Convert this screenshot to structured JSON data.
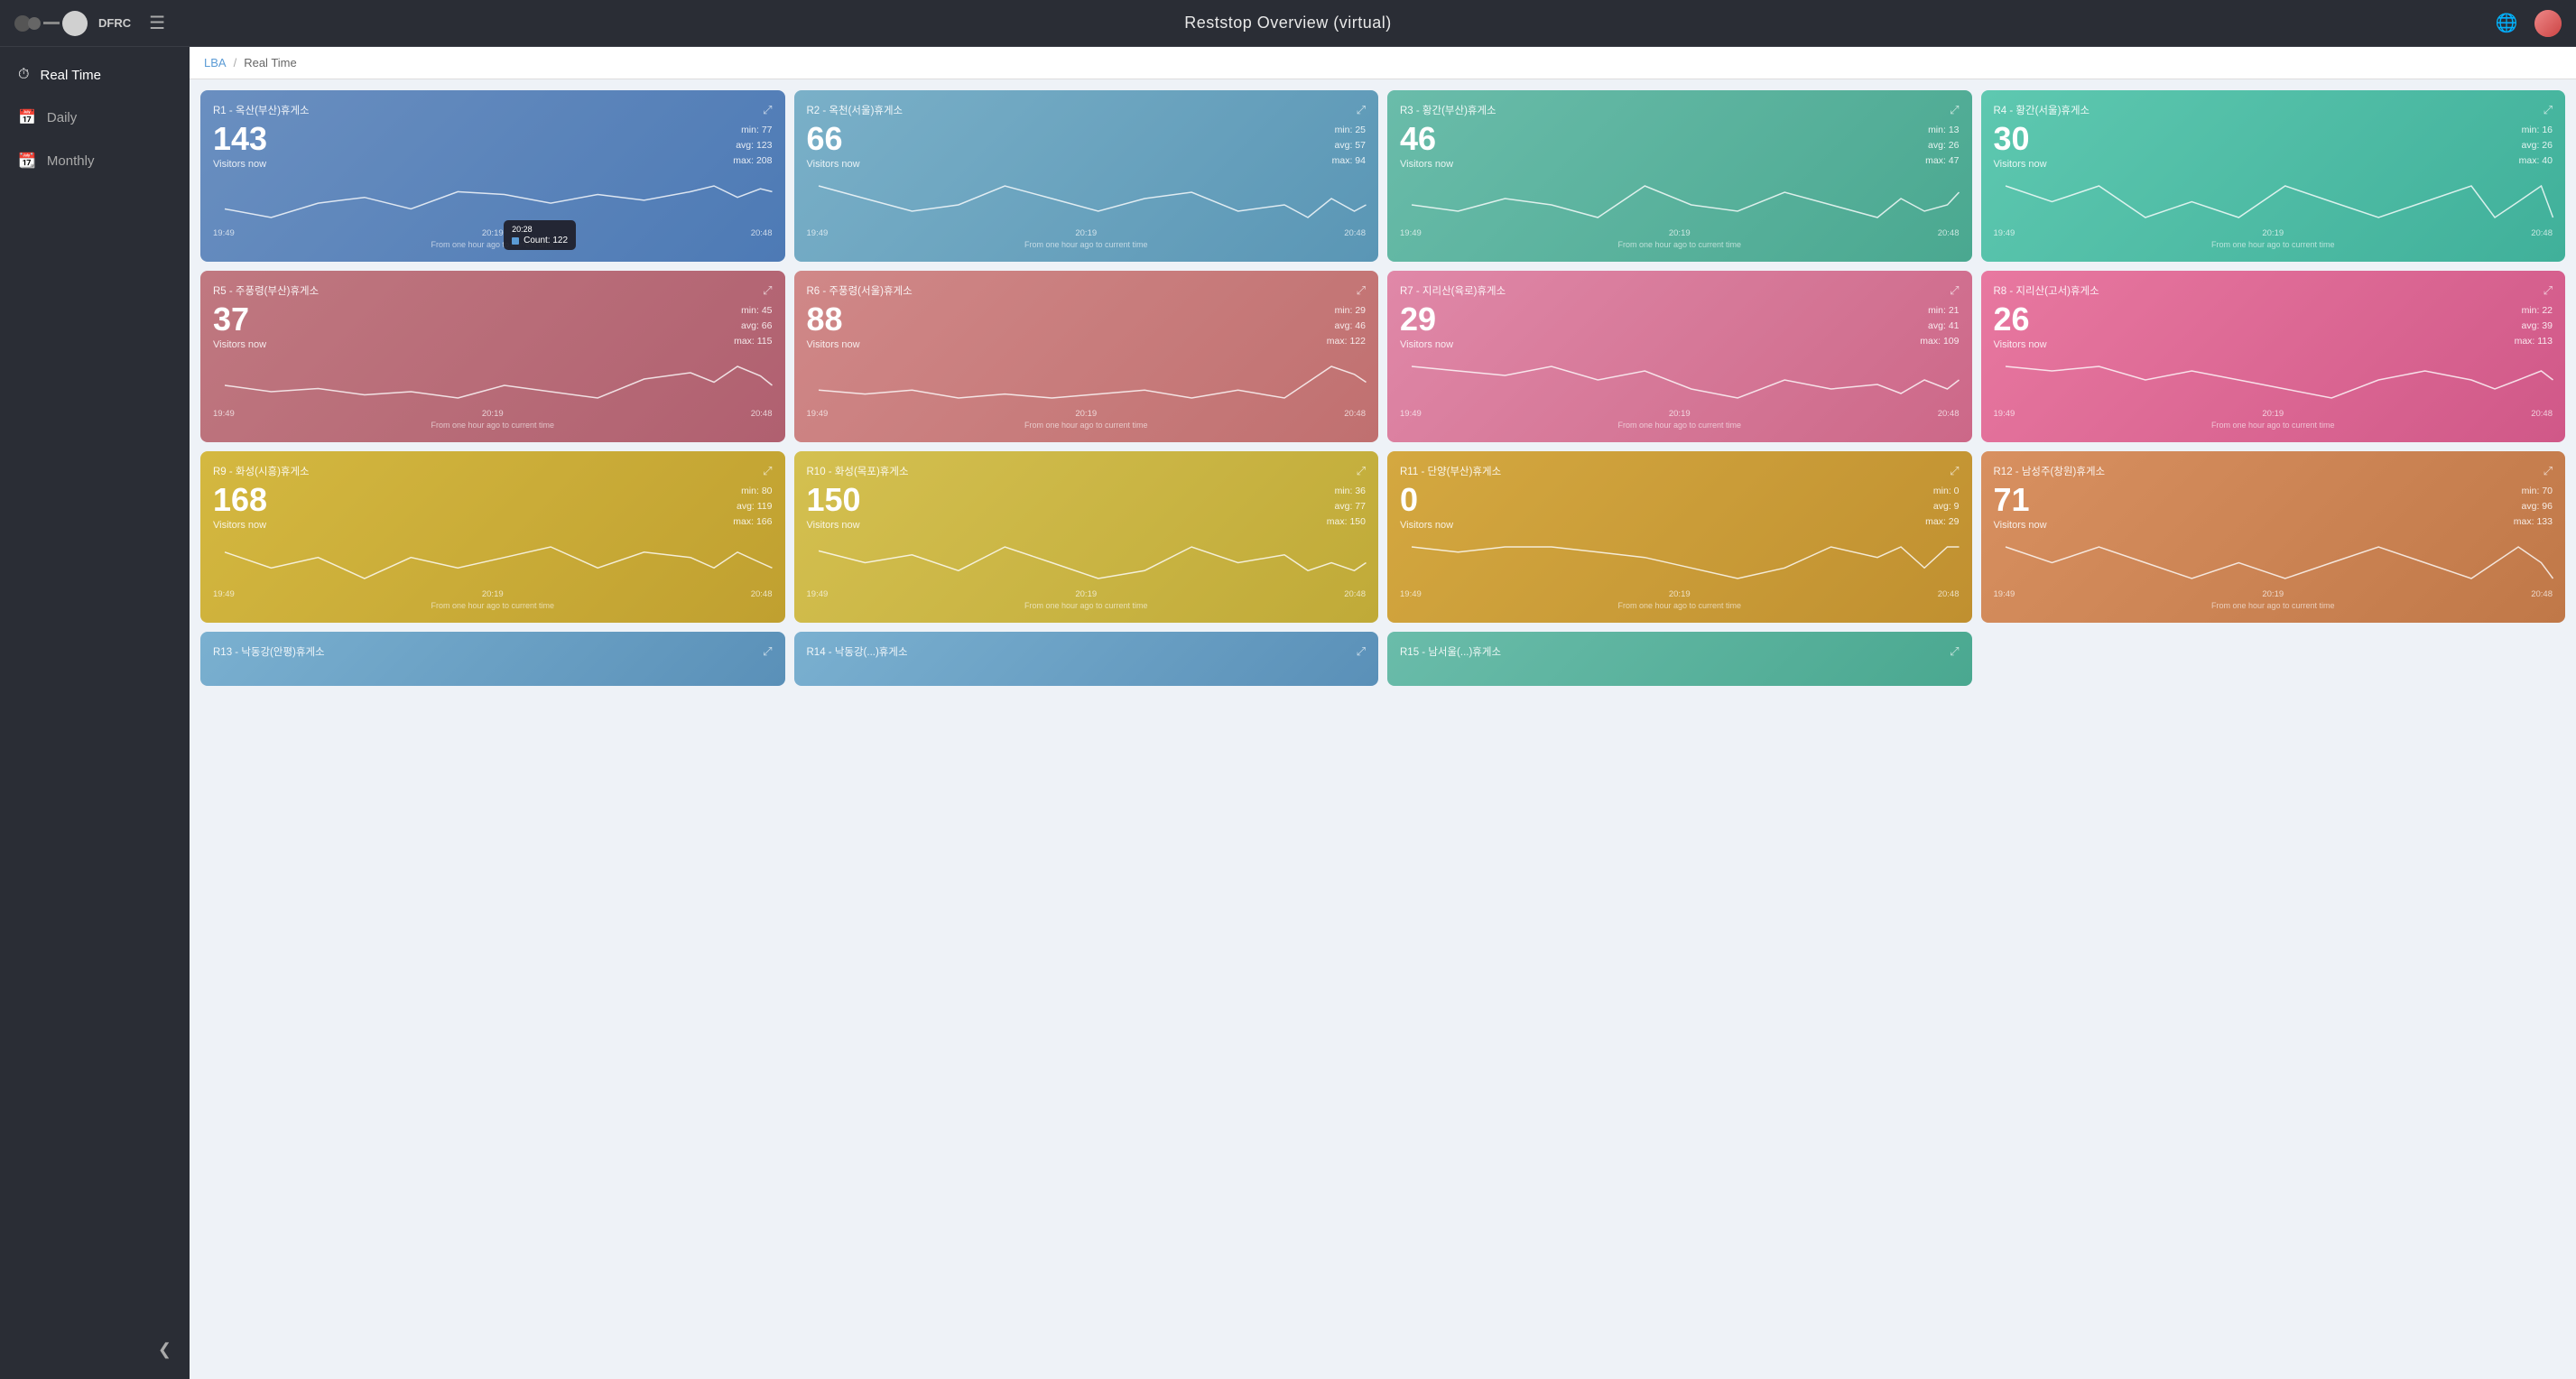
{
  "header": {
    "title": "Reststop Overview (virtual)",
    "logo_text": "DFRC"
  },
  "breadcrumb": {
    "link": "LBA",
    "separator": "/",
    "current": "Real Time"
  },
  "sidebar": {
    "items": [
      {
        "id": "realtime",
        "label": "Real Time",
        "icon": "⏱",
        "active": true
      },
      {
        "id": "daily",
        "label": "Daily",
        "icon": "📅",
        "active": false
      },
      {
        "id": "monthly",
        "label": "Monthly",
        "icon": "📆",
        "active": false
      }
    ],
    "collapse_label": "❮"
  },
  "cards": [
    {
      "id": "r1",
      "title": "R1 - 옥산(부산)휴게소",
      "count": "143",
      "label": "Visitors now",
      "min": 77,
      "avg": 123,
      "max": 208,
      "color_start": "#6a8fc0",
      "color_end": "#4d7ab5",
      "times": [
        "19:49",
        "20:19",
        "20:48"
      ],
      "footnote": "From one hour ago to current time",
      "tooltip": {
        "show": true,
        "time": "20:28",
        "count": 122
      },
      "sparkline": "5,38 25,35 45,40 65,42 85,38 105,44 125,43 145,40 165,43 185,41 205,44 215,46 225,42 235,45 240,44"
    },
    {
      "id": "r2",
      "title": "R2 - 옥천(서울)휴게소",
      "count": "66",
      "label": "Visitors now",
      "min": 25,
      "avg": 57,
      "max": 94,
      "color_start": "#7ab0c8",
      "color_end": "#5a96b5",
      "times": [
        "19:49",
        "20:19",
        "20:48"
      ],
      "footnote": "From one hour ago to current time",
      "tooltip": {
        "show": false
      },
      "sparkline": "5,42 25,40 45,38 65,39 85,42 105,40 125,38 145,40 165,41 185,38 205,39 215,37 225,40 235,38 240,39"
    },
    {
      "id": "r3",
      "title": "R3 - 황간(부산)휴게소",
      "count": "46",
      "label": "Visitors now",
      "min": 13,
      "avg": 26,
      "max": 47,
      "color_start": "#6abcaa",
      "color_end": "#4aa890",
      "times": [
        "19:49",
        "20:19",
        "20:48"
      ],
      "footnote": "From one hour ago to current time",
      "tooltip": {
        "show": false
      },
      "sparkline": "5,40 25,39 45,41 65,40 85,38 105,43 125,40 145,39 165,42 185,40 205,38 215,41 225,39 235,40 240,42"
    },
    {
      "id": "r4",
      "title": "R4 - 황간(서울)휴게소",
      "count": "30",
      "label": "Visitors now",
      "min": 16,
      "avg": 26,
      "max": 40,
      "color_start": "#5ec8b0",
      "color_end": "#40b09a",
      "times": [
        "19:49",
        "20:19",
        "20:48"
      ],
      "footnote": "From one hour ago to current time",
      "tooltip": {
        "show": false
      },
      "sparkline": "5,42 25,41 45,42 65,40 85,41 105,40 125,42 145,41 165,40 185,41 205,42 215,40 225,41 235,42 240,40"
    },
    {
      "id": "r5",
      "title": "R5 - 주풍령(부산)휴게소",
      "count": "37",
      "label": "Visitors now",
      "min": 45,
      "avg": 66,
      "max": 115,
      "color_start": "#c07880",
      "color_end": "#b06070",
      "times": [
        "19:49",
        "20:19",
        "20:48"
      ],
      "footnote": "From one hour ago to current time",
      "tooltip": {
        "show": false
      },
      "sparkline": "5,42 25,40 45,41 65,39 85,40 105,38 125,42 145,40 165,38 185,44 205,46 215,43 225,48 235,45 240,42"
    },
    {
      "id": "r6",
      "title": "R6 - 주풍령(서울)휴게소",
      "count": "88",
      "label": "Visitors now",
      "min": 29,
      "avg": 46,
      "max": 122,
      "color_start": "#d08888",
      "color_end": "#c07070",
      "times": [
        "19:49",
        "20:19",
        "20:48"
      ],
      "footnote": "From one hour ago to current time",
      "tooltip": {
        "show": false
      },
      "sparkline": "5,42 25,41 45,42 65,40 85,41 105,40 125,41 145,42 165,40 185,42 205,40 215,44 225,48 235,46 240,44"
    },
    {
      "id": "r7",
      "title": "R7 - 지리산(육로)휴게소",
      "count": "29",
      "label": "Visitors now",
      "min": 21,
      "avg": 41,
      "max": 109,
      "color_start": "#e088a8",
      "color_end": "#cc6888",
      "times": [
        "19:49",
        "20:19",
        "20:48"
      ],
      "footnote": "From one hour ago to current time",
      "tooltip": {
        "show": false
      },
      "sparkline": "5,43 25,42 45,41 65,43 85,40 105,42 125,38 145,36 165,40 185,38 205,39 215,37 225,40 235,38 240,40"
    },
    {
      "id": "r8",
      "title": "R8 - 지리산(고서)휴게소",
      "count": "26",
      "label": "Visitors now",
      "min": 22,
      "avg": 39,
      "max": 113,
      "color_start": "#e878a0",
      "color_end": "#d05888",
      "times": [
        "19:49",
        "20:19",
        "20:48"
      ],
      "footnote": "From one hour ago to current time",
      "tooltip": {
        "show": false
      },
      "sparkline": "5,43 25,42 45,43 65,40 85,42 105,40 125,38 145,36 165,40 185,42 205,40 215,38 225,40 235,42 240,40"
    },
    {
      "id": "r9",
      "title": "R9 - 화성(시흥)휴게소",
      "count": "168",
      "label": "Visitors now",
      "min": 80,
      "avg": 119,
      "max": 166,
      "color_start": "#d4b840",
      "color_end": "#c0a030",
      "times": [
        "19:49",
        "20:19",
        "20:48"
      ],
      "footnote": "From one hour ago to current time",
      "tooltip": {
        "show": false
      },
      "sparkline": "5,43 25,40 45,42 65,38 85,42 105,40 125,42 145,44 165,40 185,43 205,42 215,40 225,43 235,41 240,40"
    },
    {
      "id": "r10",
      "title": "R10 - 화성(목포)휴게소",
      "count": "150",
      "label": "Visitors now",
      "min": 36,
      "avg": 77,
      "max": 150,
      "color_start": "#d4c050",
      "color_end": "#c0aa38",
      "times": [
        "19:49",
        "20:19",
        "20:48"
      ],
      "footnote": "From one hour ago to current time",
      "tooltip": {
        "show": false
      },
      "sparkline": "5,43 25,40 45,42 65,38 85,44 105,40 125,36 145,38 165,44 185,40 205,42 215,38 225,40 235,38 240,40"
    },
    {
      "id": "r11",
      "title": "R11 - 단양(부산)휴게소",
      "count": "0",
      "label": "Visitors now",
      "min": 0,
      "avg": 9,
      "max": 29,
      "color_start": "#d4a840",
      "color_end": "#c09030",
      "times": [
        "19:49",
        "20:19",
        "20:48"
      ],
      "footnote": "From one hour ago to current time",
      "tooltip": {
        "show": false
      },
      "sparkline": "5,44 25,43 45,44 65,44 85,43 105,42 125,40 145,38 165,40 185,44 205,42 215,44 225,40 235,44 240,44"
    },
    {
      "id": "r12",
      "title": "R12 - 남성주(창원)휴게소",
      "count": "71",
      "label": "Visitors now",
      "min": 70,
      "avg": 96,
      "max": 133,
      "color_start": "#d89060",
      "color_end": "#c07848",
      "times": [
        "19:49",
        "20:19",
        "20:48"
      ],
      "footnote": "From one hour ago to current time",
      "tooltip": {
        "show": false
      },
      "sparkline": "5,43 25,42 45,43 65,42 85,41 105,42 125,41 145,42 165,43 185,42 205,41 215,42 225,43 235,42 240,41"
    }
  ],
  "partial_cards": [
    {
      "id": "r13",
      "title": "R13 - 낙동강(안평)휴게소",
      "color_start": "#7ab0d0",
      "color_end": "#5a90b8"
    },
    {
      "id": "r14",
      "title": "R14 - 낙동강(...)휴게소",
      "color_start": "#7ab0d0",
      "color_end": "#5a90b8"
    },
    {
      "id": "r15",
      "title": "R15 - 남서울(...)휴게소",
      "color_start": "#6abcaa",
      "color_end": "#4aa890"
    }
  ]
}
